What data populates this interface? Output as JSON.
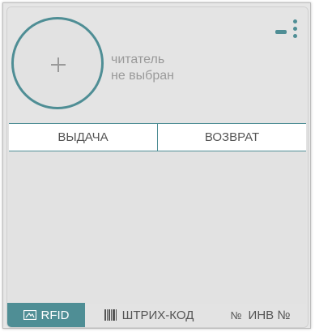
{
  "reader": {
    "status_line1": "читатель",
    "status_line2": "не выбран"
  },
  "tabs": [
    {
      "label": "ВЫДАЧА"
    },
    {
      "label": "ВОЗВРАТ"
    }
  ],
  "modes": {
    "rfid": {
      "label": "RFID",
      "active": true
    },
    "barcode": {
      "label": "ШТРИХ-КОД",
      "active": false
    },
    "inventory": {
      "icon_text": "№",
      "label": "ИНВ №",
      "active": false
    }
  },
  "colors": {
    "accent": "#4f8e95",
    "panel_bg": "#e3e3e3",
    "text_muted": "#9a9a9a",
    "text": "#555555"
  },
  "icons": {
    "add": "plus-icon",
    "minimize": "minus-icon",
    "menu": "vertical-dots-icon",
    "rfid": "rfid-card-icon",
    "barcode": "barcode-icon"
  }
}
